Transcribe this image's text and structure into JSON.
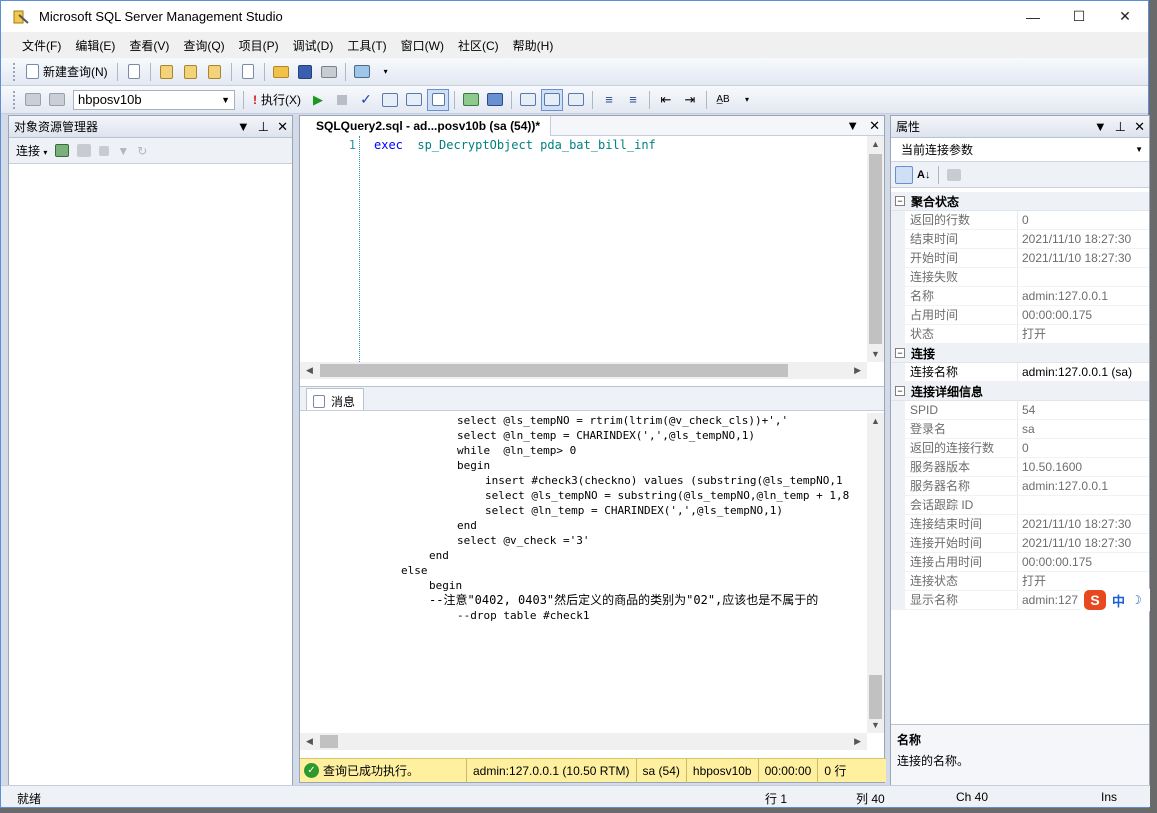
{
  "window": {
    "title": "Microsoft SQL Server Management Studio"
  },
  "menu": [
    "文件(F)",
    "编辑(E)",
    "查看(V)",
    "查询(Q)",
    "项目(P)",
    "调试(D)",
    "工具(T)",
    "窗口(W)",
    "社区(C)",
    "帮助(H)"
  ],
  "toolbar1": {
    "new_query": "新建查询(N)"
  },
  "toolbar2": {
    "database": "hbposv10b",
    "execute": "执行(X)"
  },
  "object_explorer": {
    "title": "对象资源管理器",
    "connect": "连接"
  },
  "editor": {
    "tab": "SQLQuery2.sql - ad...posv10b (sa (54))*",
    "line_number": "1",
    "code_keyword": "exec",
    "code_rest": "sp_DecryptObject pda_bat_bill_inf"
  },
  "results": {
    "tab": "消息",
    "lines": [
      "select @ls_tempNO = rtrim(ltrim(@v_check_cls))+','",
      "select @ln_temp = CHARINDEX(',',@ls_tempNO,1)",
      "while  @ln_temp> 0",
      "begin",
      "insert #check3(checkno) values (substring(@ls_tempNO,1",
      "select @ls_tempNO = substring(@ls_tempNO,@ln_temp + 1,8",
      "select @ln_temp = CHARINDEX(',',@ls_tempNO,1)",
      "end",
      "select @v_check ='3'",
      "end",
      "else",
      "begin",
      "--注意\"0402, 0403\"然后定义的商品的类别为\"02\",应该也是不属于的",
      "--drop table #check1"
    ]
  },
  "query_status": {
    "message": "查询已成功执行。",
    "server": "admin:127.0.0.1 (10.50 RTM)",
    "user": "sa (54)",
    "db": "hbposv10b",
    "time": "00:00:00",
    "rows": "0 行"
  },
  "properties": {
    "title": "属性",
    "combo": "当前连接参数",
    "categories": [
      {
        "name": "聚合状态",
        "rows": [
          {
            "k": "返回的行数",
            "v": "0"
          },
          {
            "k": "结束时间",
            "v": "2021/11/10 18:27:30"
          },
          {
            "k": "开始时间",
            "v": "2021/11/10 18:27:30"
          },
          {
            "k": "连接失败",
            "v": ""
          },
          {
            "k": "名称",
            "v": "admin:127.0.0.1"
          },
          {
            "k": "占用时间",
            "v": "00:00:00.175"
          },
          {
            "k": "状态",
            "v": "打开"
          }
        ]
      },
      {
        "name": "连接",
        "rows": [
          {
            "k": "连接名称",
            "v": "admin:127.0.0.1 (sa)"
          }
        ]
      },
      {
        "name": "连接详细信息",
        "rows": [
          {
            "k": "SPID",
            "v": "54"
          },
          {
            "k": "登录名",
            "v": "sa"
          },
          {
            "k": "返回的连接行数",
            "v": "0"
          },
          {
            "k": "服务器版本",
            "v": "10.50.1600"
          },
          {
            "k": "服务器名称",
            "v": "admin:127.0.0.1"
          },
          {
            "k": "会话跟踪 ID",
            "v": ""
          },
          {
            "k": "连接结束时间",
            "v": "2021/11/10 18:27:30"
          },
          {
            "k": "连接开始时间",
            "v": "2021/11/10 18:27:30"
          },
          {
            "k": "连接占用时间",
            "v": "00:00:00.175"
          },
          {
            "k": "连接状态",
            "v": "打开"
          },
          {
            "k": "显示名称",
            "v": "admin:127"
          }
        ]
      }
    ],
    "desc_title": "名称",
    "desc_text": "连接的名称。"
  },
  "statusbar": {
    "ready": "就绪",
    "row": "行 1",
    "col": "列 40",
    "ch": "Ch 40",
    "ins": "Ins"
  },
  "ime": {
    "label": "中"
  }
}
